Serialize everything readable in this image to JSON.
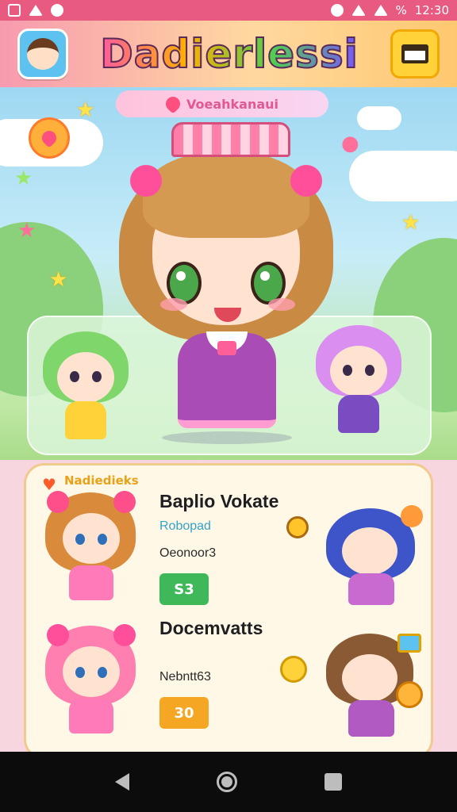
{
  "status_bar": {
    "time": "12:30",
    "battery_label": "%",
    "icons": [
      "gallery-icon",
      "usb-icon",
      "notification-icon",
      "alarm-icon",
      "wifi-icon",
      "signal-icon"
    ]
  },
  "app_bar": {
    "title": "Dadierlessi",
    "avatar_icon": "profile-avatar-icon",
    "menu_icon": "shop-icon"
  },
  "hero": {
    "banner_text": "Voeahkanaui"
  },
  "list": {
    "items": [
      {
        "tag": "Nadiedieks",
        "name": "Baplio Vokate",
        "subtitle": "Robopad",
        "meta": "Oeonoor3",
        "value": "S3",
        "value_color": "#3fb85a"
      },
      {
        "name": "Docemvatts",
        "meta": "Nebntt63",
        "value": "30",
        "value_color": "#f5a623"
      }
    ]
  },
  "nav_bar": {
    "back_icon": "back-triangle-icon",
    "home_icon": "home-circle-icon",
    "recents_icon": "recents-square-icon"
  }
}
